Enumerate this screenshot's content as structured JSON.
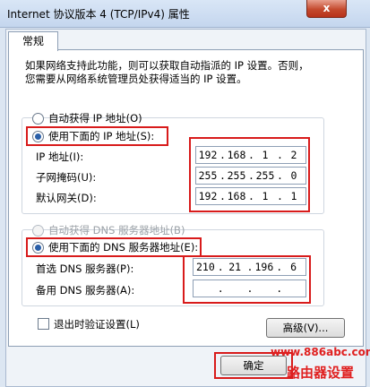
{
  "window": {
    "title": "Internet 协议版本 4 (TCP/IPv4) 属性",
    "close_label": "x"
  },
  "tabs": [
    {
      "label": "常规"
    }
  ],
  "description": [
    "如果网络支持此功能，则可以获取自动指派的 IP 设置。否则，",
    "您需要从网络系统管理员处获得适当的 IP 设置。"
  ],
  "ip_section": {
    "auto_label": "自动获得 IP 地址(O)",
    "auto_selected": false,
    "manual_label": "使用下面的 IP 地址(S):",
    "manual_selected": true,
    "fields": [
      {
        "label": "IP 地址(I):",
        "octets": [
          "192",
          "168",
          "1",
          "2"
        ]
      },
      {
        "label": "子网掩码(U):",
        "octets": [
          "255",
          "255",
          "255",
          "0"
        ]
      },
      {
        "label": "默认网关(D):",
        "octets": [
          "192",
          "168",
          "1",
          "1"
        ]
      }
    ]
  },
  "dns_section": {
    "auto_label": "自动获得 DNS 服务器地址(B)",
    "auto_enabled": false,
    "manual_label": "使用下面的 DNS 服务器地址(E):",
    "manual_selected": true,
    "fields": [
      {
        "label": "首选 DNS 服务器(P):",
        "octets": [
          "210",
          "21",
          "196",
          "6"
        ]
      },
      {
        "label": "备用 DNS 服务器(A):",
        "octets": [
          "",
          "",
          "",
          ""
        ]
      }
    ]
  },
  "validate_checkbox": {
    "label": "退出时验证设置(L)",
    "checked": false
  },
  "advanced_button": "高级(V)...",
  "ok_button": "确定",
  "watermark": {
    "url": "www.886abc.com",
    "text": "路由器设置"
  },
  "colors": {
    "highlight_border": "#d81b1b",
    "radio_dot": "#2a5fa8",
    "watermark": "#e02020"
  }
}
